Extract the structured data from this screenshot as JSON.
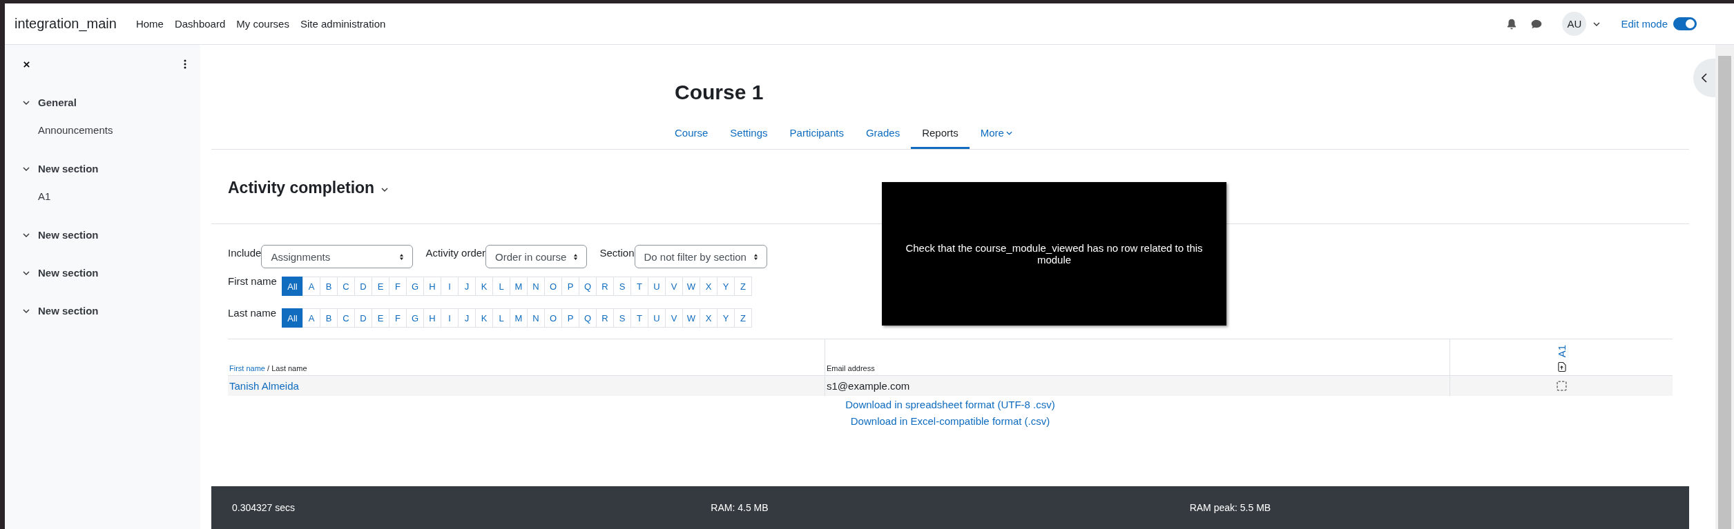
{
  "site_name": "integration_main",
  "nav": [
    {
      "label": "Home"
    },
    {
      "label": "Dashboard"
    },
    {
      "label": "My courses"
    },
    {
      "label": "Site administration"
    }
  ],
  "user": {
    "initials": "AU"
  },
  "edit_mode": {
    "label": "Edit mode",
    "on": true
  },
  "drawer": {
    "sections": [
      {
        "title": "General",
        "expanded": true,
        "children": [
          {
            "label": "Announcements"
          }
        ]
      },
      {
        "title": "New section",
        "expanded": true,
        "children": [
          {
            "label": "A1"
          }
        ]
      },
      {
        "title": "New section",
        "expanded": true
      },
      {
        "title": "New section",
        "expanded": true
      },
      {
        "title": "New section",
        "expanded": true
      }
    ]
  },
  "course": {
    "title": "Course 1",
    "tabs": [
      {
        "label": "Course",
        "selected": false,
        "kind": "link"
      },
      {
        "label": "Settings",
        "selected": false,
        "kind": "link"
      },
      {
        "label": "Participants",
        "selected": false,
        "kind": "link"
      },
      {
        "label": "Grades",
        "selected": false,
        "kind": "link"
      },
      {
        "label": "Reports",
        "selected": true,
        "kind": "link"
      },
      {
        "label": "More",
        "selected": false,
        "kind": "menu"
      }
    ]
  },
  "report": {
    "title": "Activity completion",
    "filters": [
      {
        "label": "Include",
        "value": "Assignments"
      },
      {
        "label": "Activity order",
        "value": "Order in course"
      },
      {
        "label": "Section",
        "value": "Do not filter by section"
      }
    ],
    "initials_bars": [
      {
        "label": "First name",
        "letters": [
          {
            "label": "All",
            "selected": true
          },
          {
            "label": "A",
            "selected": false
          },
          {
            "label": "B",
            "selected": false
          },
          {
            "label": "C",
            "selected": false
          },
          {
            "label": "D",
            "selected": false
          },
          {
            "label": "E",
            "selected": false
          },
          {
            "label": "F",
            "selected": false
          },
          {
            "label": "G",
            "selected": false
          },
          {
            "label": "H",
            "selected": false
          },
          {
            "label": "I",
            "selected": false
          },
          {
            "label": "J",
            "selected": false
          },
          {
            "label": "K",
            "selected": false
          },
          {
            "label": "L",
            "selected": false
          },
          {
            "label": "M",
            "selected": false
          },
          {
            "label": "N",
            "selected": false
          },
          {
            "label": "O",
            "selected": false
          },
          {
            "label": "P",
            "selected": false
          },
          {
            "label": "Q",
            "selected": false
          },
          {
            "label": "R",
            "selected": false
          },
          {
            "label": "S",
            "selected": false
          },
          {
            "label": "T",
            "selected": false
          },
          {
            "label": "U",
            "selected": false
          },
          {
            "label": "V",
            "selected": false
          },
          {
            "label": "W",
            "selected": false
          },
          {
            "label": "X",
            "selected": false
          },
          {
            "label": "Y",
            "selected": false
          },
          {
            "label": "Z",
            "selected": false
          }
        ]
      },
      {
        "label": "Last name",
        "letters": [
          {
            "label": "All",
            "selected": true
          },
          {
            "label": "A",
            "selected": false
          },
          {
            "label": "B",
            "selected": false
          },
          {
            "label": "C",
            "selected": false
          },
          {
            "label": "D",
            "selected": false
          },
          {
            "label": "E",
            "selected": false
          },
          {
            "label": "F",
            "selected": false
          },
          {
            "label": "G",
            "selected": false
          },
          {
            "label": "H",
            "selected": false
          },
          {
            "label": "I",
            "selected": false
          },
          {
            "label": "J",
            "selected": false
          },
          {
            "label": "K",
            "selected": false
          },
          {
            "label": "L",
            "selected": false
          },
          {
            "label": "M",
            "selected": false
          },
          {
            "label": "N",
            "selected": false
          },
          {
            "label": "O",
            "selected": false
          },
          {
            "label": "P",
            "selected": false
          },
          {
            "label": "Q",
            "selected": false
          },
          {
            "label": "R",
            "selected": false
          },
          {
            "label": "S",
            "selected": false
          },
          {
            "label": "T",
            "selected": false
          },
          {
            "label": "U",
            "selected": false
          },
          {
            "label": "V",
            "selected": false
          },
          {
            "label": "W",
            "selected": false
          },
          {
            "label": "X",
            "selected": false
          },
          {
            "label": "Y",
            "selected": false
          },
          {
            "label": "Z",
            "selected": false
          }
        ]
      }
    ],
    "table": {
      "name_header": {
        "sort_link": "First name",
        "rest": "/ Last name"
      },
      "email_header": "Email address",
      "activities": [
        "A1"
      ],
      "rows": [
        {
          "name": "Tanish Almeida",
          "email": "s1@example.com",
          "completion": [
            {
              "completed": false
            }
          ]
        }
      ]
    },
    "downloads": [
      "Download in spreadsheet format (UTF-8 .csv)",
      "Download in Excel-compatible format (.csv)"
    ]
  },
  "overlay": {
    "message": "Check that the course_module_viewed has no row related to this module"
  },
  "footer": [
    "0.304327 secs",
    "RAM: 4.5 MB",
    "RAM peak: 5.5 MB"
  ]
}
